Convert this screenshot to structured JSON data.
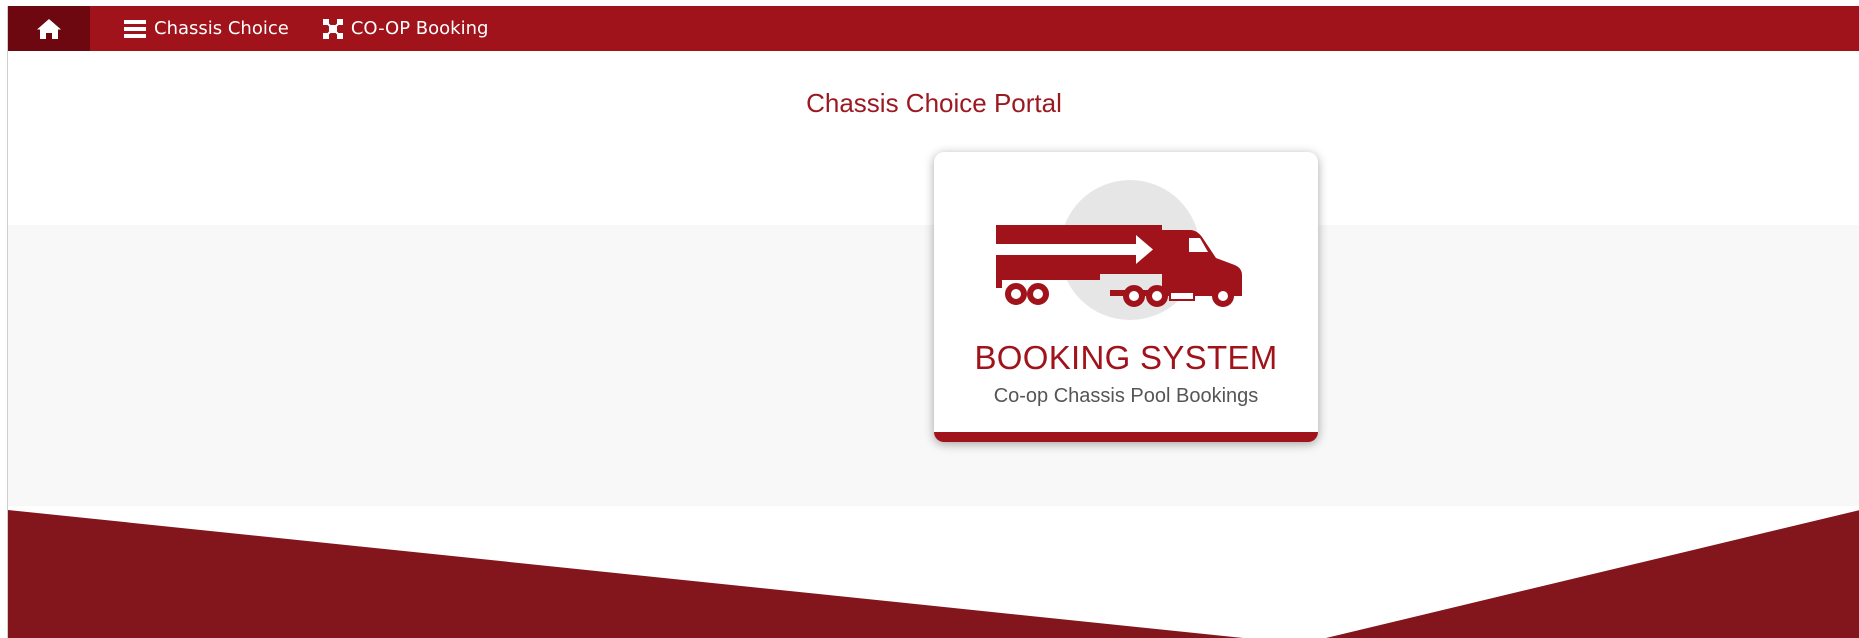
{
  "nav": {
    "home_icon": "home-icon",
    "items": [
      {
        "label": "Chassis Choice",
        "icon": "menu-icon"
      },
      {
        "label": "CO-OP Booking",
        "icon": "network-icon"
      }
    ]
  },
  "main": {
    "portal_title": "Chassis Choice Portal",
    "card": {
      "icon": "truck-icon",
      "title": "BOOKING SYSTEM",
      "subtitle": "Co-op Chassis Pool Bookings"
    }
  },
  "colors": {
    "brand_red": "#a0131b",
    "dark_red": "#6d0810",
    "bottom_red": "#83161d",
    "light_gray": "#f8f8f8"
  }
}
